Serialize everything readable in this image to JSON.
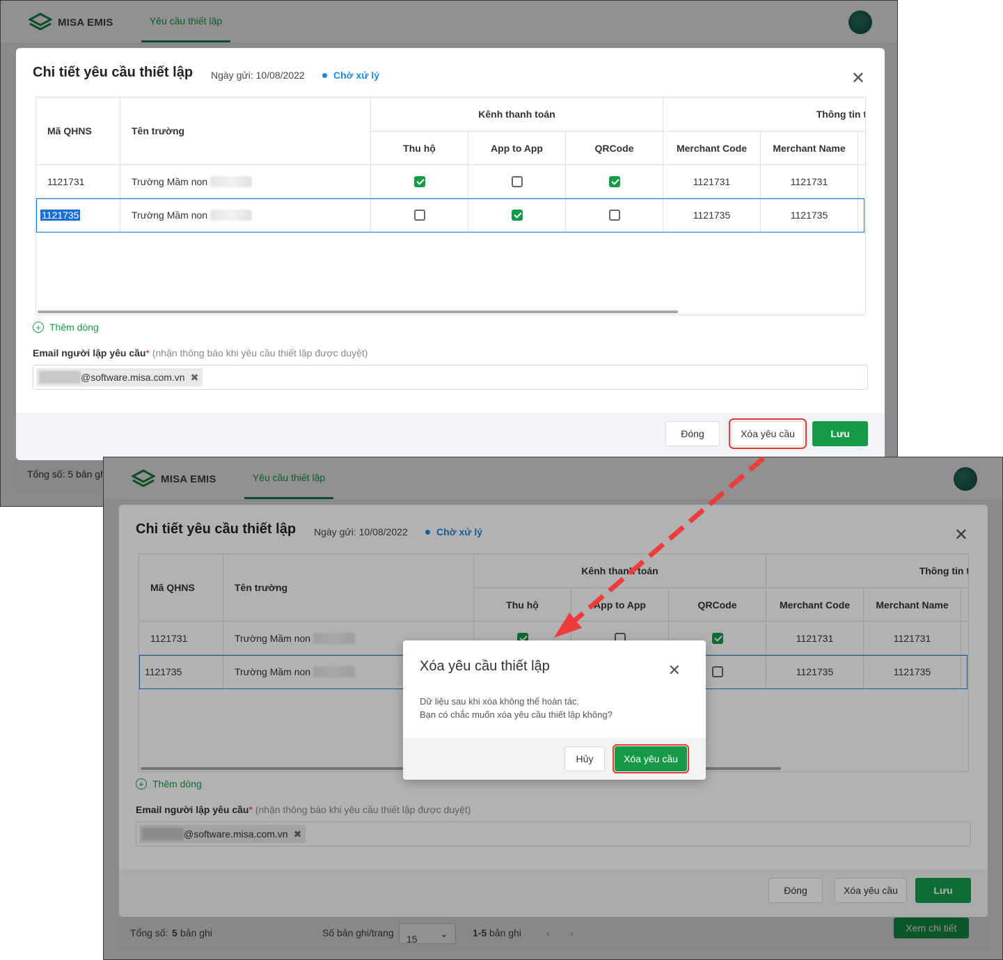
{
  "app": {
    "brand": "MISA EMIS",
    "nav_tab": "Yêu cầu thiết lập"
  },
  "modal": {
    "title": "Chi tiết yêu cầu thiết lập",
    "date": "Ngày gửi: 10/08/2022",
    "status": "Chờ xử lý",
    "headers": {
      "ma_qhns": "Mã QHNS",
      "ten_truong": "Tên trường",
      "kenh": "Kênh thanh toán",
      "thongtin": "Thông tin t",
      "thu_ho": "Thu hộ",
      "app_to_app": "App to App",
      "qrcode": "QRCode",
      "merchant_code": "Merchant Code",
      "merchant_name": "Merchant Name"
    },
    "rows": [
      {
        "ma": "1121731",
        "ten": "Trường Mầm non",
        "thu_ho": true,
        "app": false,
        "qr": true,
        "mcode": "1121731",
        "mname": "1121731"
      },
      {
        "ma": "1121735",
        "ten": "Trường Mầm non",
        "thu_ho": false,
        "app": true,
        "qr": false,
        "mcode": "1121735",
        "mname": "1121735"
      }
    ],
    "add_row": "Thêm dòng",
    "email_label": "Email người lập yêu cầu",
    "email_required": "*",
    "email_hint": "(nhận thông báo khi yêu cầu thiết lập được duyệt)",
    "email_suffix": "@software.misa.com.vn",
    "btn_close": "Đóng",
    "btn_delete": "Xóa yêu cầu",
    "btn_save": "Lưu"
  },
  "footer": {
    "total_label": "Tổng số:",
    "total_value": "5",
    "total_unit": "bản ghi",
    "per_page_label": "Số bản ghi/trang",
    "per_page_value": "15",
    "range_value": "1-5",
    "range_unit": "bản ghi",
    "detail_btn": "Xem chi tiết",
    "total_short": "Tổng số:  5 bản gh"
  },
  "confirm": {
    "title": "Xóa yêu cầu thiết lập",
    "line1": "Dữ liệu sau khi xóa không thể hoàn tác.",
    "line2": "Bạn có chắc muốn xóa yêu cầu thiết lập không?",
    "btn_cancel": "Hủy",
    "btn_confirm": "Xóa yêu cầu"
  },
  "colors": {
    "primary": "#159a4a",
    "status_blue": "#1a87e0",
    "highlight_red": "#e53935"
  }
}
